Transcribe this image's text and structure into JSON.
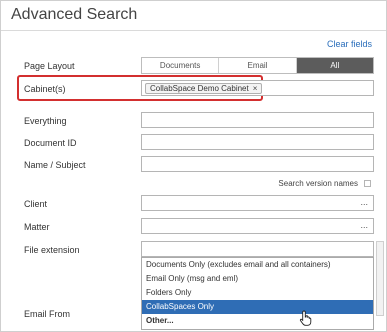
{
  "header": {
    "title": "Advanced Search",
    "clear_filters": "Clear fields"
  },
  "page_layout": {
    "label": "Page Layout",
    "options": [
      "Documents",
      "Email",
      "All"
    ],
    "active": "All"
  },
  "cabinets": {
    "label": "Cabinet(s)",
    "chip": "CollabSpace Demo Cabinet",
    "chip_remove": "×"
  },
  "fields": {
    "everything": "Everything",
    "document_id": "Document ID",
    "name_subject": "Name / Subject",
    "search_version_names": "Search version names",
    "client": "Client",
    "matter": "Matter",
    "file_extension": "File extension",
    "email_from": "Email From",
    "ellipsis": "..."
  },
  "file_extension_dropdown": {
    "items": [
      "Documents Only (excludes email and all containers)",
      "Email Only (msg and eml)",
      "Folders Only",
      "CollabSpaces Only",
      "Other..."
    ],
    "selected": "CollabSpaces Only"
  },
  "icons": {
    "cursor": "hand-pointer-icon"
  },
  "colors": {
    "highlight": "#d32f2f",
    "selected": "#2f6db5",
    "active_segment": "#5c5c5c",
    "link": "#2a6ebb"
  }
}
